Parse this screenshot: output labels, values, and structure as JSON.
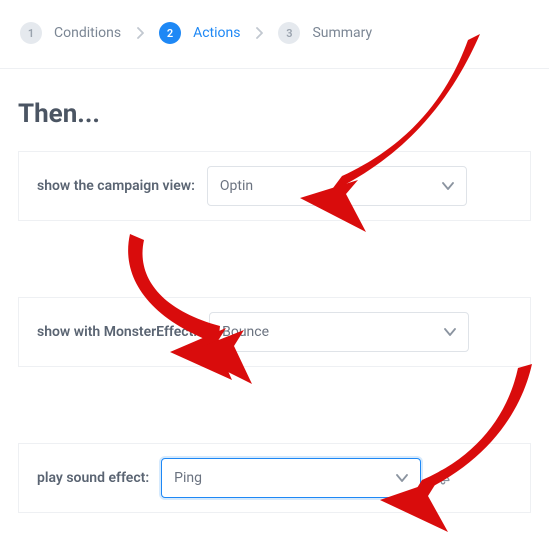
{
  "stepper": {
    "steps": [
      {
        "num": "1",
        "label": "Conditions",
        "active": false
      },
      {
        "num": "2",
        "label": "Actions",
        "active": true
      },
      {
        "num": "3",
        "label": "Summary",
        "active": false
      }
    ]
  },
  "main": {
    "then_title": "Then...",
    "rows": {
      "campaign_view": {
        "label": "show the campaign view:",
        "value": "Optin"
      },
      "monster_effect": {
        "label": "show with MonsterEffect:",
        "value": "Bounce"
      },
      "sound_effect": {
        "label": "play sound effect:",
        "value": "Ping"
      }
    }
  },
  "colors": {
    "accent": "#1e88f5",
    "arrow": "#d90c0c"
  }
}
